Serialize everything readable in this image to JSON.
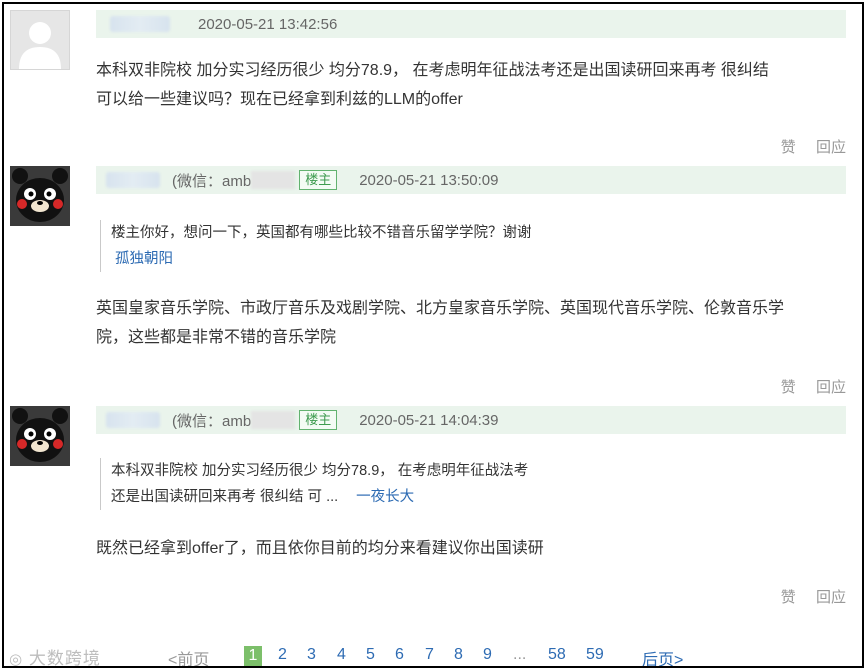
{
  "posts": [
    {
      "time": "2020-05-21 13:42:56",
      "body_line1": "本科双非院校 加分实习经历很少 均分78.9， 在考虑明年征战法考还是出国读研回来再考 很纠结",
      "body_line2": "可以给一些建议吗？现在已经拿到利兹的LLM的offer",
      "like": "赞",
      "reply": "回应"
    },
    {
      "wechat_prefix": "(微信：amb",
      "badge": "楼主",
      "time": "2020-05-21 13:50:09",
      "quote_text": "楼主你好，想问一下，英国都有哪些比较不错音乐留学学院？谢谢",
      "quote_author": "孤独朝阳",
      "body_line1": "英国皇家音乐学院、市政厅音乐及戏剧学院、北方皇家音乐学院、英国现代音乐学院、伦敦音乐学",
      "body_line2": "院，这些都是非常不错的音乐学院",
      "like": "赞",
      "reply": "回应"
    },
    {
      "wechat_prefix": "(微信：amb",
      "badge": "楼主",
      "time": "2020-05-21 14:04:39",
      "quote_line1": "本科双非院校 加分实习经历很少 均分78.9， 在考虑明年征战法考",
      "quote_line2": "还是出国读研回来再考 很纠结 可 ...",
      "quote_author": "一夜长大",
      "body_line1": "既然已经拿到offer了，而且依你目前的均分来看建议你出国读研",
      "like": "赞",
      "reply": "回应"
    }
  ],
  "pager": {
    "prev": "<前页",
    "current": "1",
    "pages": [
      "2",
      "3",
      "4",
      "5",
      "6",
      "7",
      "8",
      "9"
    ],
    "ellipsis": "...",
    "p58": "58",
    "p59": "59",
    "next": "后页>"
  },
  "watermark": "大数跨境"
}
